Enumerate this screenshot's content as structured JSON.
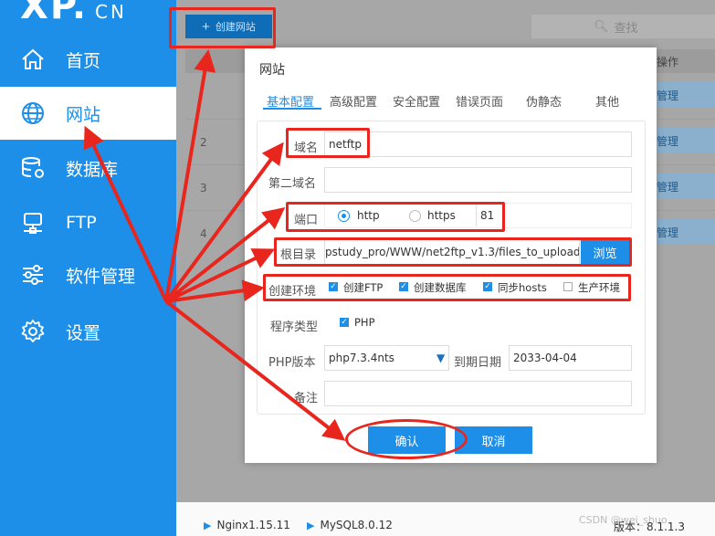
{
  "app": {
    "logo_main": "XP.",
    "logo_suffix": "CN"
  },
  "sidebar": {
    "items": [
      {
        "label": "首页",
        "icon": "home-icon"
      },
      {
        "label": "网站",
        "icon": "globe-icon",
        "active": true
      },
      {
        "label": "数据库",
        "icon": "database-icon"
      },
      {
        "label": "FTP",
        "icon": "ftp-icon"
      },
      {
        "label": "软件管理",
        "icon": "sliders-icon"
      },
      {
        "label": "设置",
        "icon": "gear-icon"
      }
    ]
  },
  "toolbar": {
    "create_label": "创建网站",
    "search_placeholder": "查找"
  },
  "table": {
    "op_header": "操作",
    "rows": [
      {
        "num": "",
        "action": "管理"
      },
      {
        "num": "2",
        "action": "管理"
      },
      {
        "num": "3",
        "action": "管理"
      },
      {
        "num": "4",
        "action": "管理"
      }
    ]
  },
  "dialog": {
    "title": "网站",
    "tabs": [
      "基本配置",
      "高级配置",
      "安全配置",
      "错误页面",
      "伪静态",
      "其他"
    ],
    "active_tab": 0,
    "form": {
      "domain_label": "域名",
      "domain_value": "netftp",
      "second_domain_label": "第二域名",
      "second_domain_value": "",
      "port_label": "端口",
      "protocol_http": "http",
      "protocol_https": "https",
      "protocol_selected": "http",
      "port_value": "81",
      "root_label": "根目录",
      "root_value": "pstudy_pro/WWW/net2ftp_v1.3/files_to_upload",
      "browse_label": "浏览",
      "env_label": "创建环境",
      "env_options": [
        {
          "label": "创建FTP",
          "checked": true
        },
        {
          "label": "创建数据库",
          "checked": true
        },
        {
          "label": "同步hosts",
          "checked": true
        },
        {
          "label": "生产环境",
          "checked": false
        }
      ],
      "program_type_label": "程序类型",
      "program_type_option": "PHP",
      "php_version_label": "PHP版本",
      "php_version_value": "php7.3.4nts",
      "expire_label": "到期日期",
      "expire_value": "2033-04-04",
      "note_label": "备注",
      "note_value": ""
    },
    "confirm_label": "确认",
    "cancel_label": "取消"
  },
  "footer": {
    "services": [
      "Nginx1.15.11",
      "MySQL8.0.12"
    ],
    "version": "版本：8.1.1.3",
    "watermark": "CSDN @wei_shuo"
  },
  "colors": {
    "accent": "#1e8fe8",
    "annotation": "#e8261e",
    "overlay": "#a7a7a7"
  }
}
